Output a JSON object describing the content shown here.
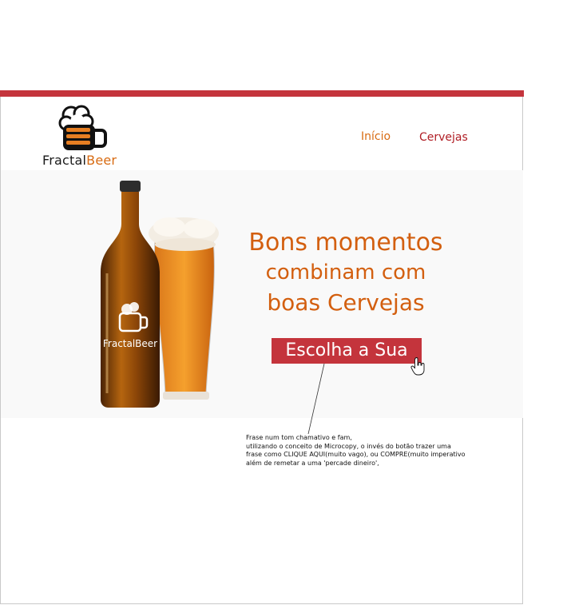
{
  "brand": {
    "name_part1": "Fractal",
    "name_part2": "Beer",
    "bottle_label": "FractalBeer"
  },
  "nav": {
    "home_label": "Início",
    "beers_label": "Cervejas"
  },
  "hero": {
    "headline_line1": "Bons momentos",
    "headline_line2": "combinam com",
    "headline_line3": "boas Cervejas",
    "cta_label": "Escolha a Sua"
  },
  "annotation": {
    "line1": "Frase num tom chamativo e fam,",
    "line2": "utilizando o conceito de Microcopy, o invés do botão trazer uma",
    "line3": "frase como CLIQUE AQUI(muito vago), ou COMPRE(muito imperativo",
    "line4": "além de remetar a uma 'percade dineiro',"
  },
  "icons": {
    "logo": "beer-mug-icon",
    "cursor": "hand-pointer-icon"
  },
  "colors": {
    "accent_red": "#c4343c",
    "orange": "#d35f0f",
    "nav_red": "#b01d24"
  }
}
